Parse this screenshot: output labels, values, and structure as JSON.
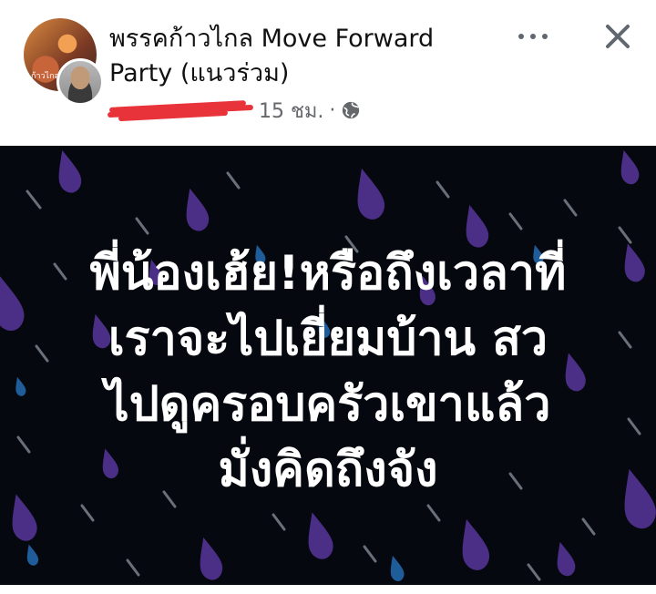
{
  "post": {
    "page_name_line1": "พรรคก้าวไกล Move Forward",
    "page_name_line2": "Party (แนวร่วม)",
    "time_text": "15 ชม.",
    "separator": "·",
    "avatar_caption": "ก้าวไกล",
    "image_text": {
      "line1": "พี่น้องเฮ้ย!หรือถึงเวลาที่",
      "line2": "เราจะไปเยี่ยมบ้าน สว",
      "line3": "ไปดูครอบครัวเขาแล้ว",
      "line4": "มั่งคิดถึงจัง"
    }
  },
  "icons": {
    "more": "more-horizontal-icon",
    "close": "close-icon",
    "privacy": "globe-icon"
  },
  "colors": {
    "image_background": "#06080f",
    "raindrop_purple": "#4b2f86",
    "raindrop_blue": "#1f5c9a",
    "redaction": "#e8333a",
    "meta_text": "#65676b"
  }
}
